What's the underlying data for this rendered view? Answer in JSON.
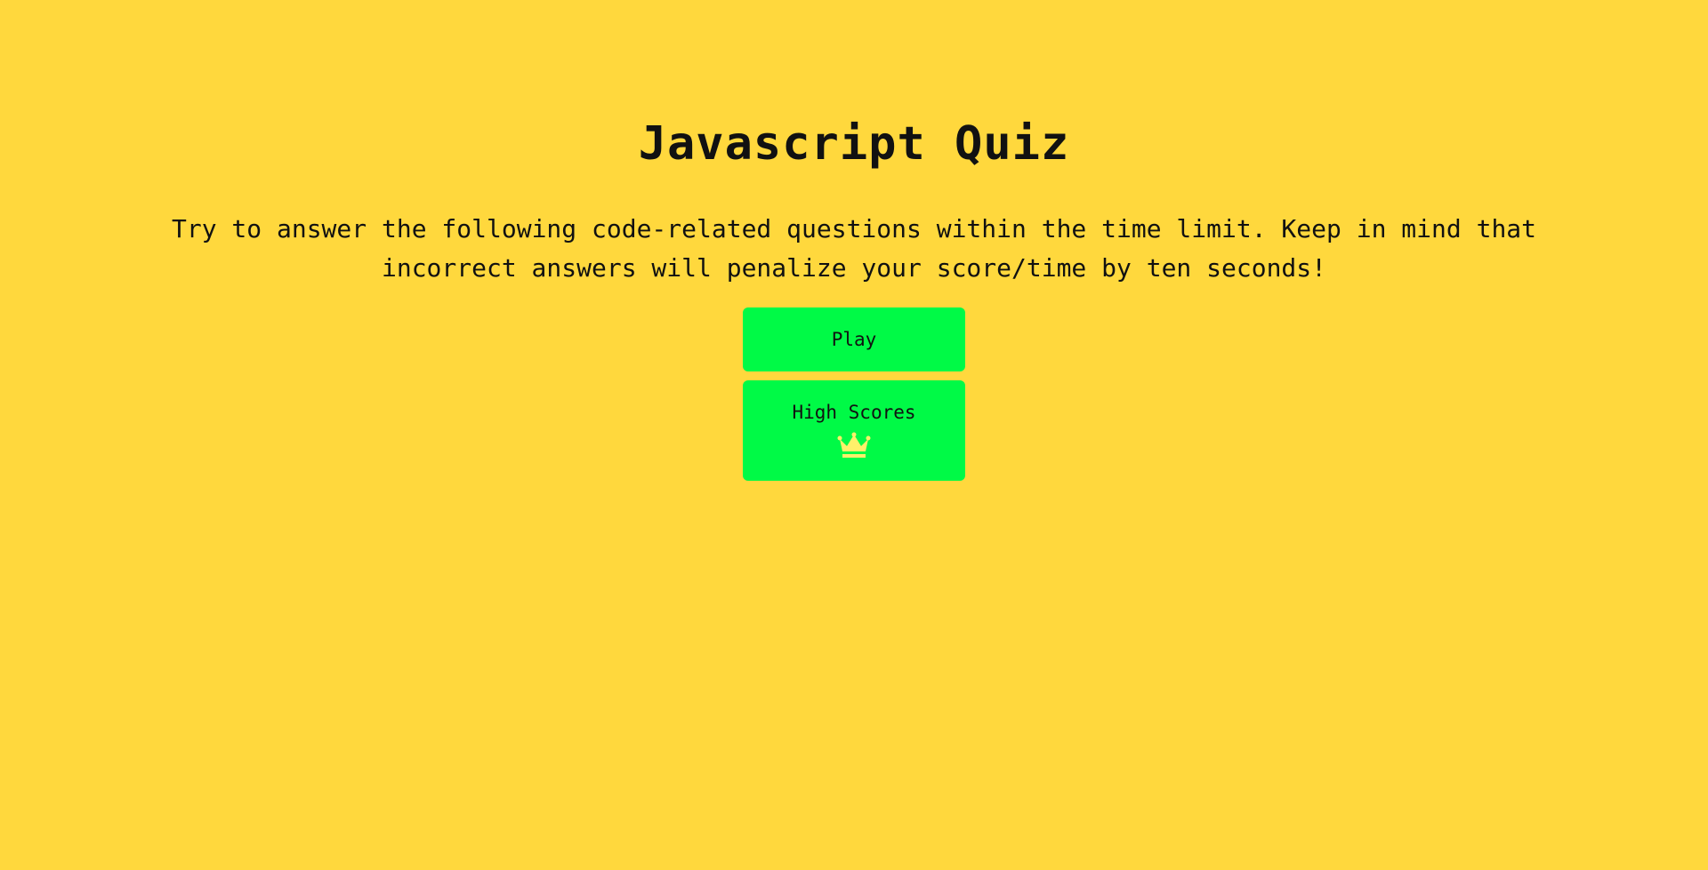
{
  "app": {
    "title": "Javascript Quiz",
    "intro": "Try to answer the following code-related questions within the time limit. Keep in mind that incorrect answers will penalize your score/time by ten seconds!"
  },
  "buttons": {
    "play_label": "Play",
    "high_scores_label": "High Scores",
    "high_scores_icon": "crown-icon"
  },
  "colors": {
    "background": "#FFD83D",
    "button": "#00FA46",
    "crown": "#FFF06A",
    "text": "#111111"
  }
}
